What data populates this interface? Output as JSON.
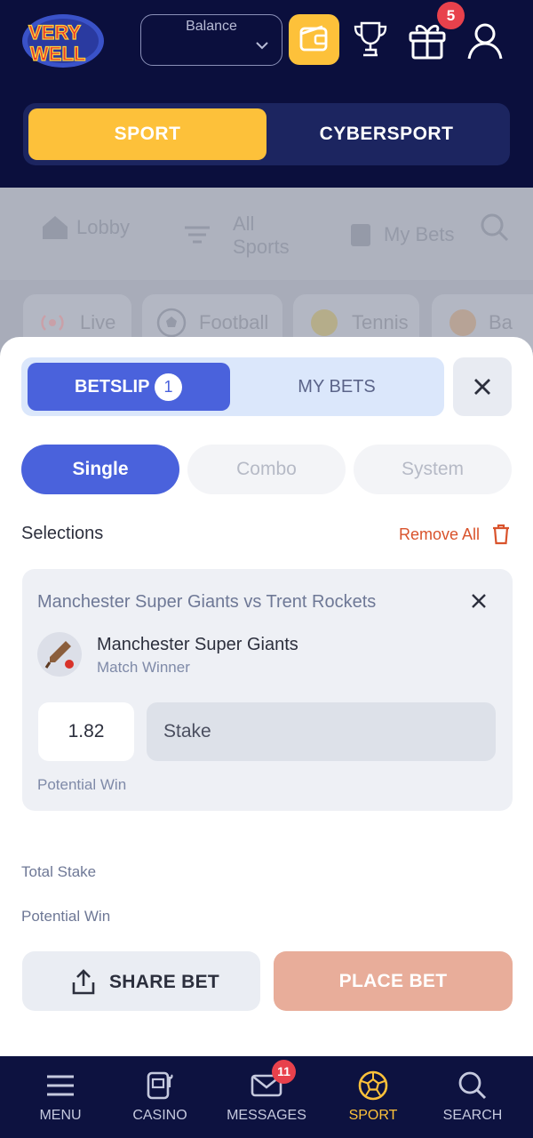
{
  "header": {
    "logo_text": "VERY WELL",
    "balance_label": "Balance",
    "gift_badge": "5"
  },
  "sport_toggle": {
    "sport_label": "SPORT",
    "cybersport_label": "CYBERSPORT"
  },
  "background_nav": {
    "items": [
      "Lobby",
      "All Sports",
      "My Bets"
    ],
    "chips": [
      "Live",
      "Football",
      "Tennis",
      "Ba"
    ]
  },
  "betslip": {
    "tab_betslip": "BETSLIP",
    "tab_count": "1",
    "tab_mybets": "MY BETS",
    "types": [
      "Single",
      "Combo",
      "System"
    ],
    "selections_title": "Selections",
    "remove_all": "Remove All",
    "selection": {
      "match": "Manchester Super Giants vs Trent Rockets",
      "team": "Manchester Super Giants",
      "market": "Match Winner",
      "odds": "1.82",
      "stake_placeholder": "Stake",
      "potential_win_label": "Potential Win"
    },
    "total_stake_label": "Total Stake",
    "potential_win_label": "Potential Win",
    "share_label": "SHARE BET",
    "place_label": "PLACE BET"
  },
  "bottom_nav": {
    "items": [
      "MENU",
      "CASINO",
      "MESSAGES",
      "SPORT",
      "SEARCH"
    ],
    "messages_badge": "11",
    "active": "SPORT"
  },
  "colors": {
    "header_bg": "#0b0f3d",
    "accent_yellow": "#fdc13a",
    "primary_blue": "#4a62dc",
    "place_bet": "#e8ad9a",
    "badge_red": "#e8414c",
    "remove_orange": "#d9532c"
  }
}
